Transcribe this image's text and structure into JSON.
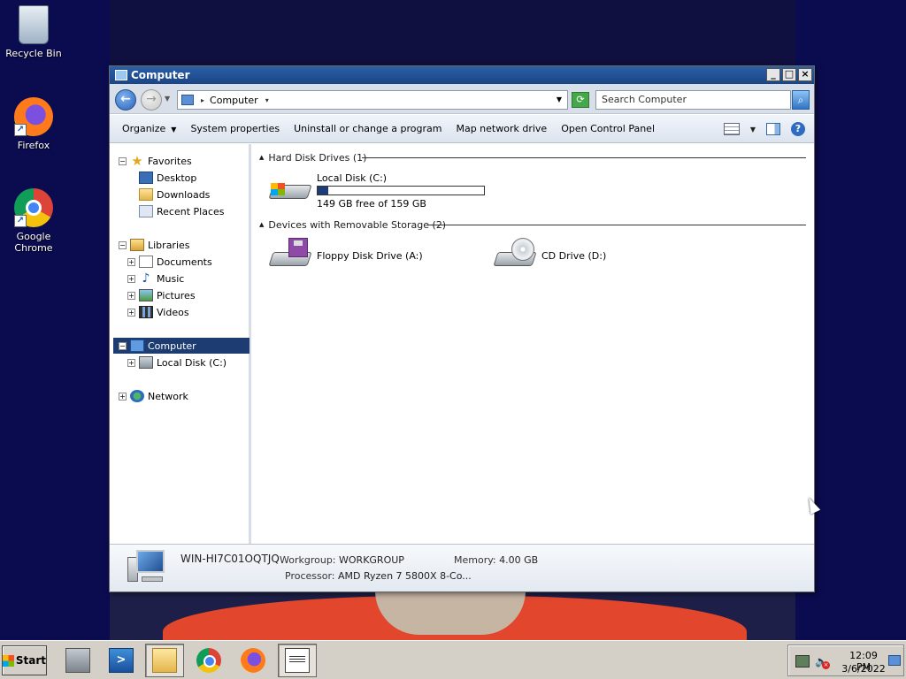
{
  "desktop": {
    "icons": [
      {
        "label": "Recycle Bin",
        "icon": "recycle-bin-icon"
      },
      {
        "label": "Firefox",
        "icon": "firefox-icon"
      },
      {
        "label": "Google Chrome",
        "icon": "chrome-icon"
      }
    ]
  },
  "window": {
    "title": "Computer",
    "controls": {
      "minimize": "_",
      "maximize": "□",
      "close": "×"
    },
    "address": {
      "path": "Computer"
    },
    "search": {
      "placeholder": "Search Computer"
    },
    "commands": {
      "organize": "Organize",
      "system_properties": "System properties",
      "uninstall": "Uninstall or change a program",
      "map_drive": "Map network drive",
      "control_panel": "Open Control Panel"
    },
    "help": "?",
    "nav": {
      "favorites": "Favorites",
      "desktop": "Desktop",
      "downloads": "Downloads",
      "recent": "Recent Places",
      "libraries": "Libraries",
      "documents": "Documents",
      "music": "Music",
      "pictures": "Pictures",
      "videos": "Videos",
      "computer": "Computer",
      "local_disk": "Local Disk (C:)",
      "network": "Network"
    },
    "content": {
      "hdd_group": "Hard Disk Drives (1)",
      "removable_group": "Devices with Removable Storage (2)",
      "local_disk": {
        "name": "Local Disk (C:)",
        "free_text": "149 GB free of 159 GB",
        "used_fraction": 0.063
      },
      "floppy": {
        "name": "Floppy Disk Drive (A:)"
      },
      "cd": {
        "name": "CD Drive (D:)"
      }
    },
    "details": {
      "computer_name": "WIN-HI7C01OQTJQ",
      "workgroup_label": "Workgroup:",
      "workgroup": "WORKGROUP",
      "memory_label": "Memory:",
      "memory": "4.00 GB",
      "processor_label": "Processor:",
      "processor": "AMD Ryzen 7 5800X 8-Co..."
    }
  },
  "taskbar": {
    "start_label": "Start",
    "clock_time": "12:09 PM",
    "clock_date": "3/6/2022"
  },
  "colors": {
    "desktop": "#0b0b50",
    "titlebar": "#1b4585",
    "selection": "#1c3c72",
    "capacity_fill": "#1d3d7a"
  }
}
